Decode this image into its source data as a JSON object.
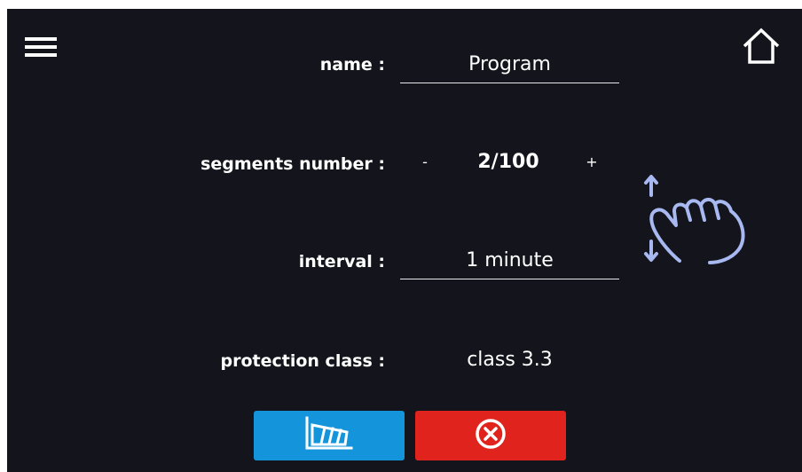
{
  "form": {
    "name_label": "name :",
    "name_value": "Program",
    "segments_label": "segments number :",
    "segments_minus": "-",
    "segments_value": "2/100",
    "segments_plus": "+",
    "interval_label": "interval :",
    "interval_value": "1 minute",
    "protection_label": "protection class :",
    "protection_value": "class 3.3"
  },
  "icons": {
    "menu": "hamburger-icon",
    "home": "home-icon",
    "gesture": "swipe-vertical-hand-icon",
    "chart": "chart-profile-icon",
    "cancel": "cancel-circle-icon"
  },
  "colors": {
    "background": "#14141c",
    "accent_blue": "#1495db",
    "accent_red": "#e0231d",
    "gesture": "#a8b8f0"
  }
}
